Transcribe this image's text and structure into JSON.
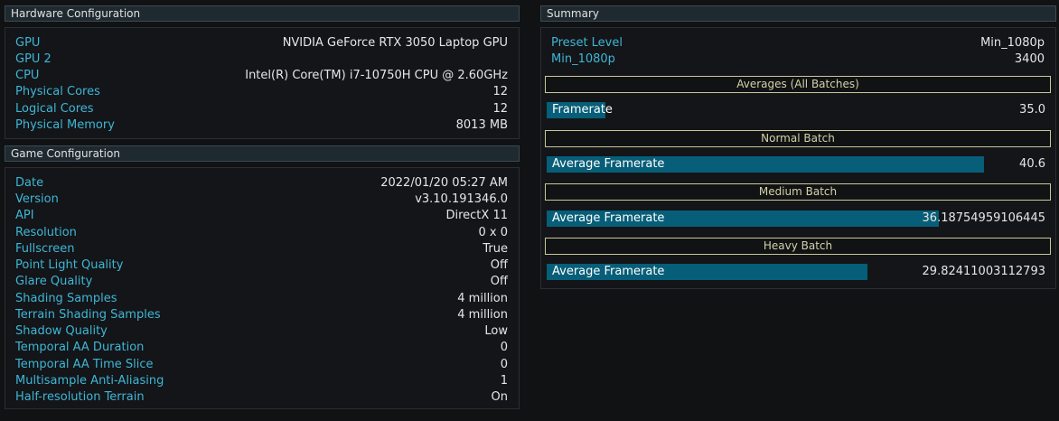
{
  "hardware": {
    "title": "Hardware Configuration",
    "rows": [
      {
        "key": "GPU",
        "value": "NVIDIA GeForce RTX 3050 Laptop GPU"
      },
      {
        "key": "GPU 2",
        "value": ""
      },
      {
        "key": "CPU",
        "value": "Intel(R) Core(TM) i7-10750H CPU @ 2.60GHz"
      },
      {
        "key": "Physical Cores",
        "value": "12"
      },
      {
        "key": "Logical Cores",
        "value": "12"
      },
      {
        "key": "Physical Memory",
        "value": "8013 MB"
      }
    ]
  },
  "game": {
    "title": "Game Configuration",
    "rows": [
      {
        "key": "Date",
        "value": "2022/01/20 05:27 AM"
      },
      {
        "key": "Version",
        "value": "v3.10.191346.0"
      },
      {
        "key": "API",
        "value": "DirectX 11"
      },
      {
        "key": "Resolution",
        "value": "0 x 0"
      },
      {
        "key": "Fullscreen",
        "value": "True"
      },
      {
        "key": "Point Light Quality",
        "value": "Off"
      },
      {
        "key": "Glare Quality",
        "value": "Off"
      },
      {
        "key": "Shading Samples",
        "value": "4 million"
      },
      {
        "key": "Terrain Shading Samples",
        "value": "4 million"
      },
      {
        "key": "Shadow Quality",
        "value": "Low"
      },
      {
        "key": "Temporal AA Duration",
        "value": "0"
      },
      {
        "key": "Temporal AA Time Slice",
        "value": "0"
      },
      {
        "key": "Multisample Anti-Aliasing",
        "value": "1"
      },
      {
        "key": "Half-resolution Terrain",
        "value": "On"
      }
    ]
  },
  "summary": {
    "title": "Summary",
    "rows": [
      {
        "key": "Preset Level",
        "value": "Min_1080p"
      },
      {
        "key": "Min_1080p",
        "value": "3400"
      }
    ],
    "batches": [
      {
        "header": "Averages (All Batches)",
        "label": "Framerate",
        "value": "35.0",
        "fill_fraction": 0.117
      },
      {
        "header": "Normal Batch",
        "label": "Average Framerate",
        "value": "40.6",
        "fill_fraction": 0.877
      },
      {
        "header": "Medium Batch",
        "label": "Average Framerate",
        "value": "36.18754959106445",
        "fill_fraction": 0.787
      },
      {
        "header": "Heavy Batch",
        "label": "Average Framerate",
        "value": "29.82411003112793",
        "fill_fraction": 0.644
      }
    ]
  },
  "colors": {
    "key_text": "#3fb6d6",
    "bar_fill": "#075e78",
    "batch_border": "#c9c79a"
  }
}
